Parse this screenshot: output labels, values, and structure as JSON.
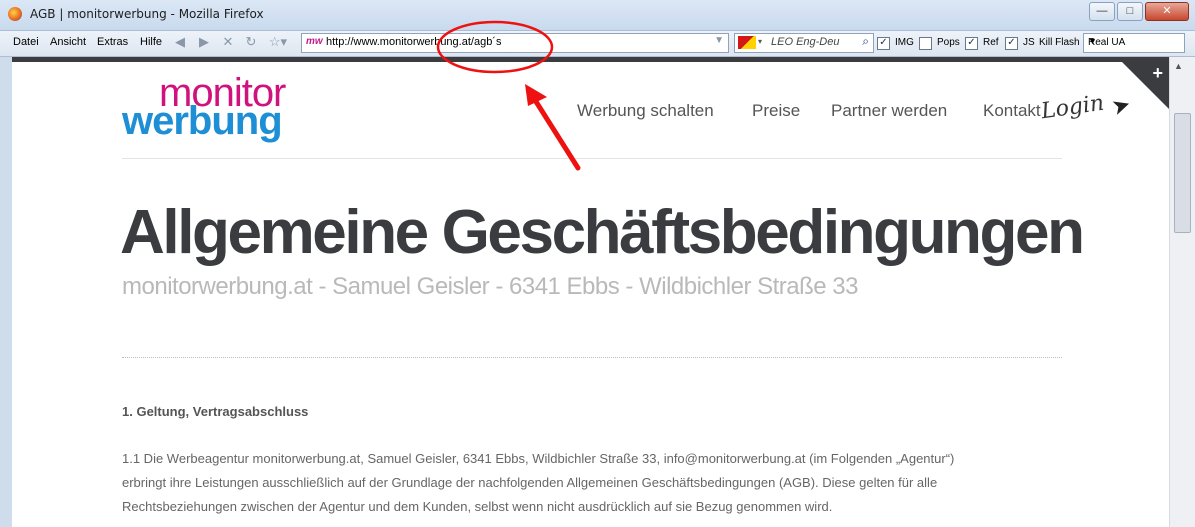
{
  "window": {
    "title": "AGB | monitorwerbung - Mozilla Firefox",
    "minimize": "—",
    "maximize": "□",
    "close": "✕"
  },
  "menu": [
    "Datei",
    "Ansicht",
    "Extras",
    "Hilfe"
  ],
  "address": {
    "url": "http://www.monitorwerbung.at/agb´s",
    "site_icon": "mw"
  },
  "search": {
    "engine": "LEO Eng-Deu"
  },
  "toggles": [
    {
      "label": "IMG",
      "checked": true
    },
    {
      "label": "Pops",
      "checked": false
    },
    {
      "label": "Ref",
      "checked": true
    },
    {
      "label": "JS",
      "checked": true
    }
  ],
  "kill_flash": "Kill Flash",
  "user_agent": "Real UA",
  "site": {
    "logo_top": "monitor",
    "logo_bottom": "werbung",
    "nav": [
      "Werbung schalten",
      "Preise",
      "Partner werden",
      "Kontakt"
    ],
    "login": "Login",
    "heading": "Allgemeine Geschäftsbedingungen",
    "subtitle": "monitorwerbung.at - Samuel Geisler - 6341 Ebbs - Wildbichler Straße 33",
    "section_title": "1. Geltung, Vertragsabschluss",
    "paragraph_lines": [
      "1.1 Die Werbeagentur monitorwerbung.at, Samuel Geisler, 6341 Ebbs, Wildbichler Straße 33, info@monitorwerbung.at (im Folgenden „Agentur“)",
      "erbringt ihre Leistungen ausschließlich auf der Grundlage der nachfolgenden Allgemeinen Geschäftsbedingungen (AGB). Diese gelten für alle",
      "Rechtsbeziehungen zwischen der Agentur und dem Kunden, selbst wenn nicht ausdrücklich auf sie Bezug genommen wird."
    ]
  },
  "colors": {
    "logo_magenta": "#d0127f",
    "logo_blue": "#1e8fd4",
    "heading": "#3a3c40",
    "annotation": "#ee1111"
  }
}
